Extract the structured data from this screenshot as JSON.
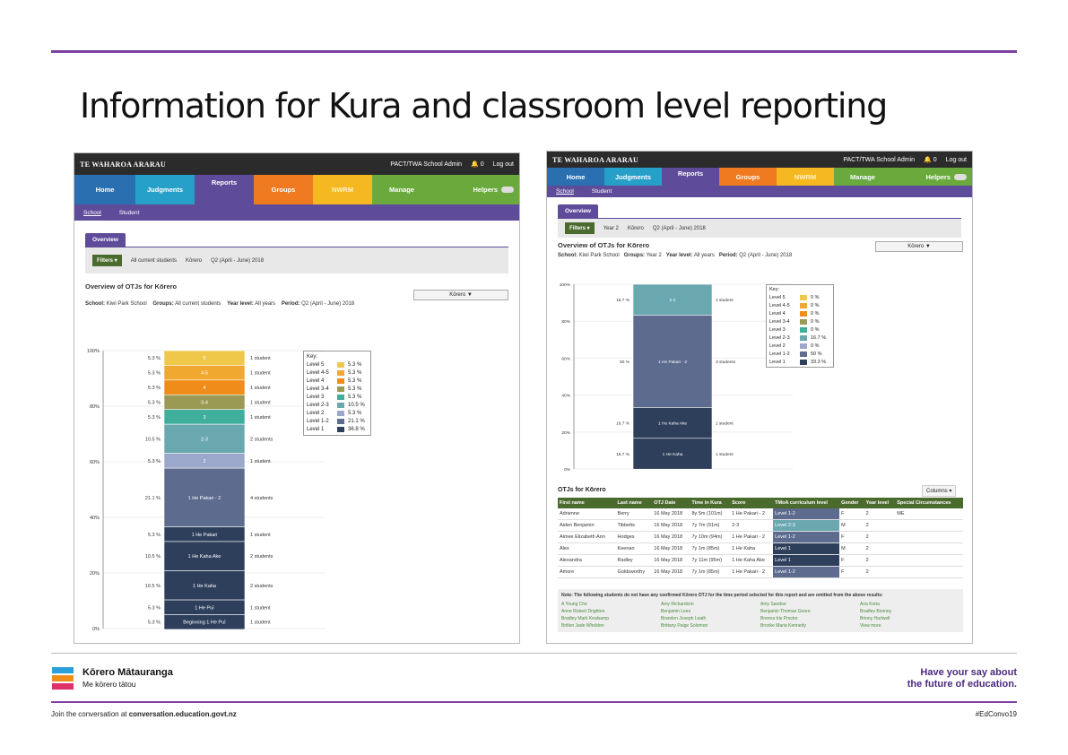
{
  "title": "Information for Kura and classroom level reporting",
  "app": {
    "brand": "TE WAHAROA ARARAU",
    "user": "PACT/TWA School Admin",
    "bell_count": "0",
    "logout": "Log out",
    "help": "?",
    "helpers": "Helpers",
    "nav": [
      "Home",
      "Judgments",
      "Reports",
      "Groups",
      "NWRM",
      "Manage"
    ],
    "subnav": [
      "School",
      "Student"
    ],
    "overview_tab": "Overview",
    "filters": "Filters ▾",
    "columns": "Columns ▾"
  },
  "left": {
    "filters_group": "All current students",
    "filters_subject": "Kōrero",
    "filters_period": "Q2 (April - June) 2018",
    "section_title": "Overview of OTJs for Kōrero",
    "dropdown": "Kōrero ▼",
    "school_label": "School:",
    "school": "Kiwi Park School",
    "groups_label": "Groups:",
    "groups": "All current students",
    "year_label": "Year level:",
    "year": "All years",
    "period_label": "Period:",
    "period": "Q2 (April - June) 2018",
    "key_title": "Key:",
    "key": [
      {
        "label": "Level 5",
        "pct": "5.3 %",
        "color": "#efc84a"
      },
      {
        "label": "Level 4-5",
        "pct": "5.3 %",
        "color": "#f0a830"
      },
      {
        "label": "Level 4",
        "pct": "5.3 %",
        "color": "#f08c1a"
      },
      {
        "label": "Level 3-4",
        "pct": "5.3 %",
        "color": "#9a9a55"
      },
      {
        "label": "Level 3",
        "pct": "5.3 %",
        "color": "#3fae9a"
      },
      {
        "label": "Level 2-3",
        "pct": "10.5 %",
        "color": "#6aa8b0"
      },
      {
        "label": "Level 2",
        "pct": "5.3 %",
        "color": "#9ba8cc"
      },
      {
        "label": "Level 1-2",
        "pct": "21.1 %",
        "color": "#5c6b8e"
      },
      {
        "label": "Level 1",
        "pct": "36.8 %",
        "color": "#2e3f5c"
      }
    ]
  },
  "right": {
    "filters_year": "Year 2",
    "filters_subject": "Kōrero",
    "filters_period": "Q2 (April - June) 2018",
    "section_title": "Overview of OTJs for Kōrero",
    "dropdown": "Kōrero ▼",
    "school_label": "School:",
    "school": "Kiwi Park School",
    "groups_label": "Groups:",
    "groups": "Year 2",
    "year_label": "Year level:",
    "year": "All years",
    "period_label": "Period:",
    "period": "Q2 (April - June) 2018",
    "key_title": "Key:",
    "key": [
      {
        "label": "Level 5",
        "pct": "0 %",
        "color": "#efc84a"
      },
      {
        "label": "Level 4-5",
        "pct": "0 %",
        "color": "#f0a830"
      },
      {
        "label": "Level 4",
        "pct": "0 %",
        "color": "#f08c1a"
      },
      {
        "label": "Level 3-4",
        "pct": "0 %",
        "color": "#9a9a55"
      },
      {
        "label": "Level 3",
        "pct": "0 %",
        "color": "#3fae9a"
      },
      {
        "label": "Level 2-3",
        "pct": "16.7 %",
        "color": "#6aa8b0"
      },
      {
        "label": "Level 2",
        "pct": "0 %",
        "color": "#9ba8cc"
      },
      {
        "label": "Level 1-2",
        "pct": "50 %",
        "color": "#5c6b8e"
      },
      {
        "label": "Level 1",
        "pct": "33.3 %",
        "color": "#2e3f5c"
      }
    ],
    "table_title": "OTJs for Kōrero",
    "table_headers": [
      "First name",
      "Last name",
      "OTJ Date",
      "Time in Kura",
      "Score",
      "TMoA curriculum level",
      "Gender",
      "Year level",
      "Special Circumstances"
    ],
    "table_rows": [
      [
        "Adrienne",
        "Berry",
        "16 May 2018",
        "8y 5m (101m)",
        "1 He Pakari - 2",
        "Level 1-2",
        "F",
        "2",
        "ME"
      ],
      [
        "Aiden Benjamin",
        "Tibbetts",
        "16 May 2018",
        "7y 7m (91m)",
        "2-3",
        "Level 2-3",
        "M",
        "2",
        ""
      ],
      [
        "Aimee Elizabeth Ann",
        "Hodges",
        "16 May 2018",
        "7y 10m (94m)",
        "1 He Pakari - 2",
        "Level 1-2",
        "F",
        "2",
        ""
      ],
      [
        "Alex",
        "Keenan",
        "16 May 2018",
        "7y 1m (85m)",
        "1 He Kaha",
        "Level 1",
        "M",
        "2",
        ""
      ],
      [
        "Alexandra",
        "Radley",
        "16 May 2018",
        "7y 11m (95m)",
        "1 He Kaha Ake",
        "Level 1",
        "F",
        "2",
        ""
      ],
      [
        "Amore",
        "Goldsworthy",
        "16 May 2018",
        "7y 1m (85m)",
        "1 He Pakari - 2",
        "Level 1-2",
        "F",
        "2",
        ""
      ]
    ],
    "note": "Note: The following students do not have any confirmed Kōrero OTJ for the time period selected for this report and are omitted from the above results:",
    "omitted": [
      "A Young Che",
      "Amy Richardson",
      "Amy Sandoe",
      "Ana Koria",
      "Anne Robert Drighton",
      "Benjamin Lees",
      "Benjamin Thomas Green",
      "Bradley Bonney",
      "Bradley Mark Kealsamp",
      "Brandon Joseph Leath",
      "Brenna Iris Proctor",
      "Briony Harlwell",
      "Britlen Jade Whelden",
      "Brittany Paige Solomon",
      "Brooke Maria Kennedy",
      "View more"
    ]
  },
  "chart_data": [
    {
      "type": "bar",
      "title": "Overview of OTJs for Kōrero",
      "stacked": true,
      "ylim": [
        0,
        100
      ],
      "yticks": [
        "100%",
        "80%",
        "60%",
        "40%",
        "20%",
        "0%"
      ],
      "segments_top_to_bottom": [
        {
          "label": "5",
          "pct": 5.3,
          "pct_label": "5.3 %",
          "count": "1 student",
          "color": "#efc84a"
        },
        {
          "label": "4-5",
          "pct": 5.3,
          "pct_label": "5.3 %",
          "count": "1 student",
          "color": "#f0a830"
        },
        {
          "label": "4",
          "pct": 5.3,
          "pct_label": "5.3 %",
          "count": "1 student",
          "color": "#f08c1a"
        },
        {
          "label": "3-4",
          "pct": 5.3,
          "pct_label": "5.3 %",
          "count": "1 student",
          "color": "#9a9a55"
        },
        {
          "label": "3",
          "pct": 5.3,
          "pct_label": "5.3 %",
          "count": "1 student",
          "color": "#3fae9a"
        },
        {
          "label": "2-3",
          "pct": 10.5,
          "pct_label": "10.5 %",
          "count": "2 students",
          "color": "#6aa8b0"
        },
        {
          "label": "2",
          "pct": 5.3,
          "pct_label": "5.3 %",
          "count": "1 student",
          "color": "#9ba8cc"
        },
        {
          "label": "1 He Pakari - 2",
          "pct": 21.1,
          "pct_label": "21.1 %",
          "count": "4 students",
          "color": "#5c6b8e"
        },
        {
          "label": "1 He Pakari",
          "pct": 5.3,
          "pct_label": "5.3 %",
          "count": "1 student",
          "color": "#2e3f5c"
        },
        {
          "label": "1 He Kaha Ake",
          "pct": 10.5,
          "pct_label": "10.5 %",
          "count": "2 students",
          "color": "#2e3f5c"
        },
        {
          "label": "1 He Kaha",
          "pct": 10.5,
          "pct_label": "10.5 %",
          "count": "2 students",
          "color": "#2e3f5c"
        },
        {
          "label": "1 He Puī",
          "pct": 5.3,
          "pct_label": "5.3 %",
          "count": "1 student",
          "color": "#2e3f5c"
        },
        {
          "label": "Beginning 1 He Puī",
          "pct": 5.3,
          "pct_label": "5.3 %",
          "count": "1 student",
          "color": "#2e3f5c"
        }
      ]
    },
    {
      "type": "bar",
      "title": "Overview of OTJs for Kōrero",
      "stacked": true,
      "ylim": [
        0,
        100
      ],
      "yticks": [
        "100%",
        "80%",
        "60%",
        "40%",
        "20%",
        "0%"
      ],
      "segments_top_to_bottom": [
        {
          "label": "2-3",
          "pct": 16.7,
          "pct_label": "16.7 %",
          "count": "1 student",
          "color": "#6aa8b0"
        },
        {
          "label": "1 He Pakari - 2",
          "pct": 50,
          "pct_label": "50 %",
          "count": "3 students",
          "color": "#5c6b8e"
        },
        {
          "label": "1 He Kaha Ake",
          "pct": 16.7,
          "pct_label": "16.7 %",
          "count": "1 student",
          "color": "#2e3f5c"
        },
        {
          "label": "1 He Kaha",
          "pct": 16.7,
          "pct_label": "16.7 %",
          "count": "1 student",
          "color": "#2e3f5c"
        }
      ]
    }
  ],
  "footer": {
    "logo_name": "Kōrero Mātauranga",
    "logo_sub": "Me kōrero tātou",
    "tagline1": "Have your say about",
    "tagline2": "the future of education.",
    "join_prefix": "Join the conversation at ",
    "join_url": "conversation.education.govt.nz",
    "hashtag": "#EdConvo19"
  }
}
